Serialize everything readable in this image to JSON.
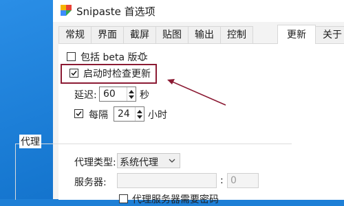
{
  "window": {
    "title": "Snipaste 首选项"
  },
  "tabs": [
    {
      "label": "常规"
    },
    {
      "label": "界面"
    },
    {
      "label": "截屏"
    },
    {
      "label": "贴图"
    },
    {
      "label": "输出"
    },
    {
      "label": "控制"
    },
    {
      "label": "更新"
    },
    {
      "label": "关于"
    }
  ],
  "active_tab": "更新",
  "update": {
    "include_beta": {
      "label": "包括 beta 版",
      "checked": false
    },
    "check_on_start": {
      "label": "启动时检查更新",
      "checked": true
    },
    "delay": {
      "label": "延迟:",
      "value": "60",
      "unit": "秒"
    },
    "every": {
      "label": "每隔",
      "checked": true,
      "value": "24",
      "unit": "小时"
    }
  },
  "proxy": {
    "group_title": "代理",
    "type_label": "代理类型:",
    "type_value": "系统代理",
    "server_label": "服务器:",
    "server_value": "",
    "port_sep": ":",
    "port_value": "0",
    "auth_label": "代理服务器需要密码"
  },
  "colors": {
    "annotation": "#8b1a33",
    "desktop": "#1677d0"
  }
}
